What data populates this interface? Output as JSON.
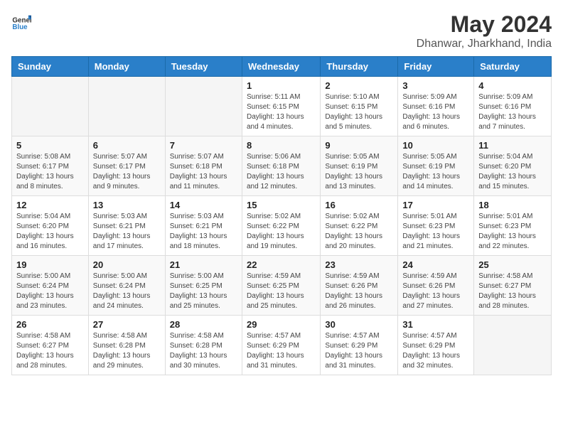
{
  "logo": {
    "text_general": "General",
    "text_blue": "Blue"
  },
  "title": "May 2024",
  "subtitle": "Dhanwar, Jharkhand, India",
  "days_of_week": [
    "Sunday",
    "Monday",
    "Tuesday",
    "Wednesday",
    "Thursday",
    "Friday",
    "Saturday"
  ],
  "weeks": [
    [
      {
        "day": "",
        "info": ""
      },
      {
        "day": "",
        "info": ""
      },
      {
        "day": "",
        "info": ""
      },
      {
        "day": "1",
        "info": "Sunrise: 5:11 AM\nSunset: 6:15 PM\nDaylight: 13 hours and 4 minutes."
      },
      {
        "day": "2",
        "info": "Sunrise: 5:10 AM\nSunset: 6:15 PM\nDaylight: 13 hours and 5 minutes."
      },
      {
        "day": "3",
        "info": "Sunrise: 5:09 AM\nSunset: 6:16 PM\nDaylight: 13 hours and 6 minutes."
      },
      {
        "day": "4",
        "info": "Sunrise: 5:09 AM\nSunset: 6:16 PM\nDaylight: 13 hours and 7 minutes."
      }
    ],
    [
      {
        "day": "5",
        "info": "Sunrise: 5:08 AM\nSunset: 6:17 PM\nDaylight: 13 hours and 8 minutes."
      },
      {
        "day": "6",
        "info": "Sunrise: 5:07 AM\nSunset: 6:17 PM\nDaylight: 13 hours and 9 minutes."
      },
      {
        "day": "7",
        "info": "Sunrise: 5:07 AM\nSunset: 6:18 PM\nDaylight: 13 hours and 11 minutes."
      },
      {
        "day": "8",
        "info": "Sunrise: 5:06 AM\nSunset: 6:18 PM\nDaylight: 13 hours and 12 minutes."
      },
      {
        "day": "9",
        "info": "Sunrise: 5:05 AM\nSunset: 6:19 PM\nDaylight: 13 hours and 13 minutes."
      },
      {
        "day": "10",
        "info": "Sunrise: 5:05 AM\nSunset: 6:19 PM\nDaylight: 13 hours and 14 minutes."
      },
      {
        "day": "11",
        "info": "Sunrise: 5:04 AM\nSunset: 6:20 PM\nDaylight: 13 hours and 15 minutes."
      }
    ],
    [
      {
        "day": "12",
        "info": "Sunrise: 5:04 AM\nSunset: 6:20 PM\nDaylight: 13 hours and 16 minutes."
      },
      {
        "day": "13",
        "info": "Sunrise: 5:03 AM\nSunset: 6:21 PM\nDaylight: 13 hours and 17 minutes."
      },
      {
        "day": "14",
        "info": "Sunrise: 5:03 AM\nSunset: 6:21 PM\nDaylight: 13 hours and 18 minutes."
      },
      {
        "day": "15",
        "info": "Sunrise: 5:02 AM\nSunset: 6:22 PM\nDaylight: 13 hours and 19 minutes."
      },
      {
        "day": "16",
        "info": "Sunrise: 5:02 AM\nSunset: 6:22 PM\nDaylight: 13 hours and 20 minutes."
      },
      {
        "day": "17",
        "info": "Sunrise: 5:01 AM\nSunset: 6:23 PM\nDaylight: 13 hours and 21 minutes."
      },
      {
        "day": "18",
        "info": "Sunrise: 5:01 AM\nSunset: 6:23 PM\nDaylight: 13 hours and 22 minutes."
      }
    ],
    [
      {
        "day": "19",
        "info": "Sunrise: 5:00 AM\nSunset: 6:24 PM\nDaylight: 13 hours and 23 minutes."
      },
      {
        "day": "20",
        "info": "Sunrise: 5:00 AM\nSunset: 6:24 PM\nDaylight: 13 hours and 24 minutes."
      },
      {
        "day": "21",
        "info": "Sunrise: 5:00 AM\nSunset: 6:25 PM\nDaylight: 13 hours and 25 minutes."
      },
      {
        "day": "22",
        "info": "Sunrise: 4:59 AM\nSunset: 6:25 PM\nDaylight: 13 hours and 25 minutes."
      },
      {
        "day": "23",
        "info": "Sunrise: 4:59 AM\nSunset: 6:26 PM\nDaylight: 13 hours and 26 minutes."
      },
      {
        "day": "24",
        "info": "Sunrise: 4:59 AM\nSunset: 6:26 PM\nDaylight: 13 hours and 27 minutes."
      },
      {
        "day": "25",
        "info": "Sunrise: 4:58 AM\nSunset: 6:27 PM\nDaylight: 13 hours and 28 minutes."
      }
    ],
    [
      {
        "day": "26",
        "info": "Sunrise: 4:58 AM\nSunset: 6:27 PM\nDaylight: 13 hours and 28 minutes."
      },
      {
        "day": "27",
        "info": "Sunrise: 4:58 AM\nSunset: 6:28 PM\nDaylight: 13 hours and 29 minutes."
      },
      {
        "day": "28",
        "info": "Sunrise: 4:58 AM\nSunset: 6:28 PM\nDaylight: 13 hours and 30 minutes."
      },
      {
        "day": "29",
        "info": "Sunrise: 4:57 AM\nSunset: 6:29 PM\nDaylight: 13 hours and 31 minutes."
      },
      {
        "day": "30",
        "info": "Sunrise: 4:57 AM\nSunset: 6:29 PM\nDaylight: 13 hours and 31 minutes."
      },
      {
        "day": "31",
        "info": "Sunrise: 4:57 AM\nSunset: 6:29 PM\nDaylight: 13 hours and 32 minutes."
      },
      {
        "day": "",
        "info": ""
      }
    ]
  ]
}
